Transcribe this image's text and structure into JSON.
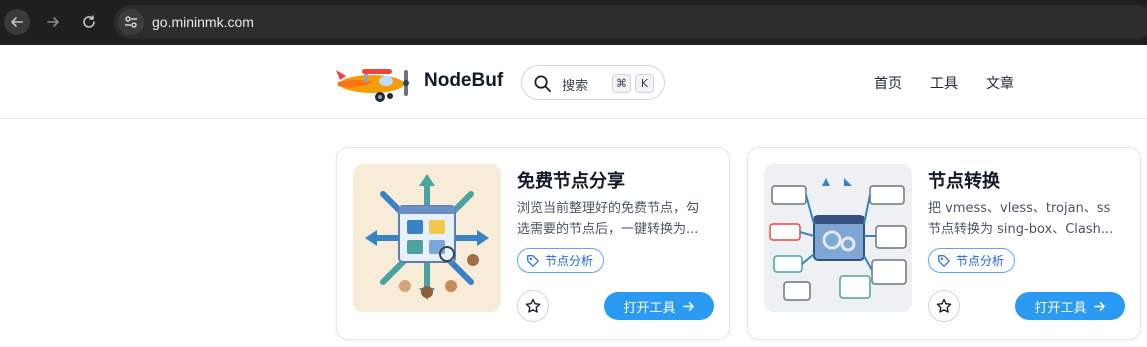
{
  "browser": {
    "url": "go.mininmk.com",
    "back_icon": "arrow-left-icon",
    "forward_icon": "arrow-right-icon",
    "reload_icon": "reload-icon",
    "site_info_icon": "tune-icon"
  },
  "header": {
    "brand": "NodeBuf",
    "logo": "airplane-logo",
    "search": {
      "label": "搜索",
      "shortcut_mod": "⌘",
      "shortcut_key": "K"
    },
    "nav": [
      "首页",
      "工具",
      "文章"
    ]
  },
  "cards": [
    {
      "title": "免费节点分享",
      "desc_line1": "浏览当前整理好的免费节点，勾",
      "desc_line2": "选需要的节点后，一键转换为...",
      "tag": "节点分析",
      "button": "打开工具"
    },
    {
      "title": "节点转换",
      "desc_line1": "把 vmess、vless、trojan、ss",
      "desc_line2": "节点转换为 sing-box、Clash...",
      "tag": "节点分析",
      "button": "打开工具"
    }
  ],
  "colors": {
    "accent": "#2b9af3",
    "tag": "#2563eb",
    "chrome": "#1f1f1f"
  }
}
